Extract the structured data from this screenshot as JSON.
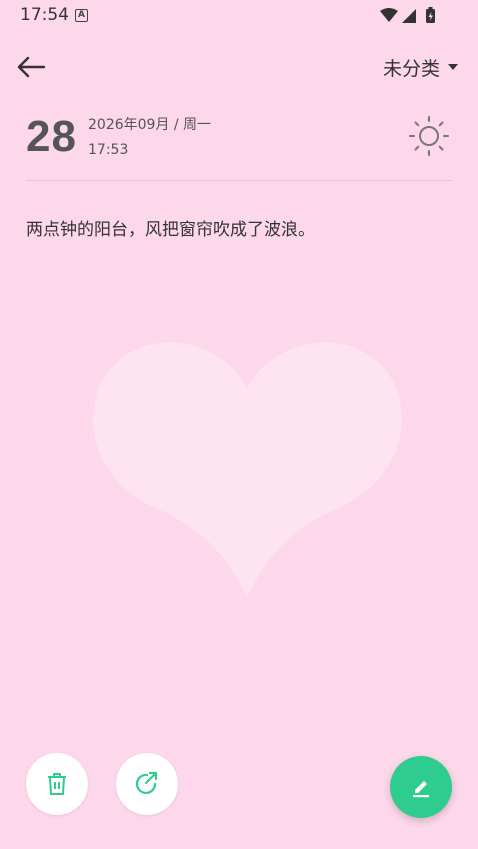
{
  "status": {
    "time": "17:54",
    "notif_icon": "a-letter-icon"
  },
  "header": {
    "category": "未分类"
  },
  "entry": {
    "day": "28",
    "date": "2026年09月 / 周一",
    "time": "17:53",
    "weather": "sun-icon",
    "text": "两点钟的阳台，风把窗帘吹成了波浪。"
  },
  "colors": {
    "background": "#fdd7ea",
    "accent": "#2ecc8e",
    "text": "#333333"
  }
}
